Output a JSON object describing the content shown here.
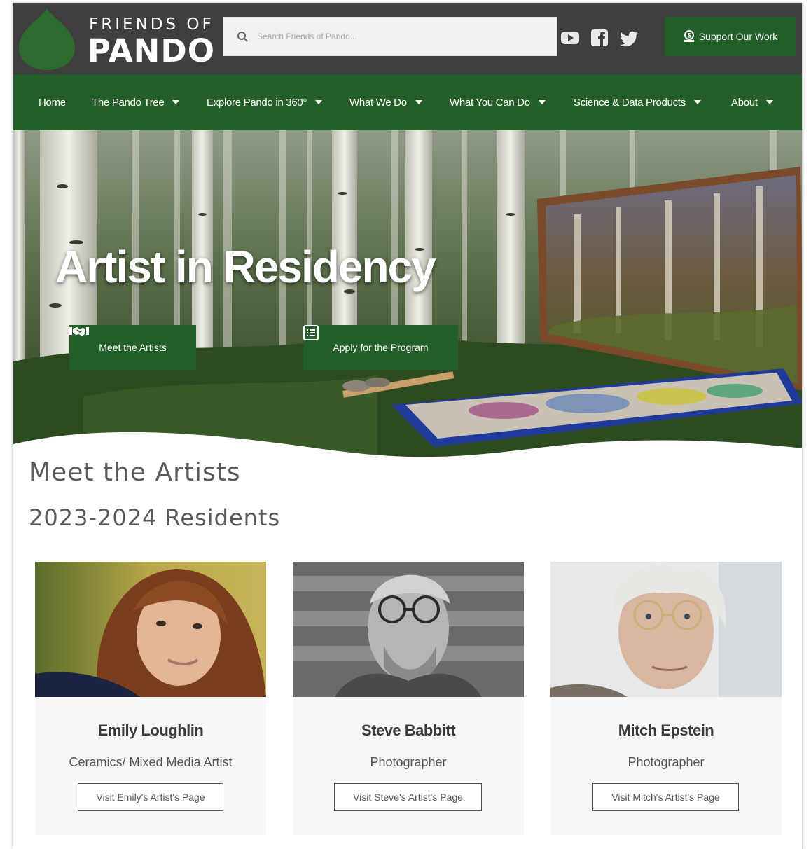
{
  "header": {
    "logo_top": "FRIENDS OF",
    "logo_bottom": "PANDO",
    "search_placeholder": "Search Friends of Pando...",
    "social": [
      "youtube-icon",
      "facebook-icon",
      "twitter-icon"
    ],
    "support_label": "Support Our Work"
  },
  "nav": {
    "items": [
      {
        "label": "Home",
        "dropdown": false
      },
      {
        "label": "The Pando Tree",
        "dropdown": true
      },
      {
        "label": "Explore Pando in 360°",
        "dropdown": true
      },
      {
        "label": "What We Do",
        "dropdown": true
      },
      {
        "label": "What You Can Do",
        "dropdown": true
      },
      {
        "label": "Science & Data Products",
        "dropdown": true
      },
      {
        "label": "About",
        "dropdown": true
      }
    ]
  },
  "hero": {
    "title": "Artist in Residency",
    "buttons": {
      "meet": "Meet the Artists",
      "apply": "Apply for the Program"
    }
  },
  "content": {
    "title": "Meet the Artists",
    "subtitle": "2023-2024 Residents",
    "artists": [
      {
        "name": "Emily Loughlin",
        "role": "Ceramics/ Mixed Media Artist",
        "button": "Visit Emily's Artist's Page"
      },
      {
        "name": "Steve Babbitt",
        "role": "Photographer",
        "button": "Visit Steve's Artist's Page"
      },
      {
        "name": "Mitch Epstein",
        "role": "Photographer",
        "button": "Visit Mitch's Artist's Page"
      }
    ]
  },
  "colors": {
    "header_bg": "#3f3f3f",
    "brand_green": "#245f2a",
    "text_gray": "#5a5a5a"
  }
}
